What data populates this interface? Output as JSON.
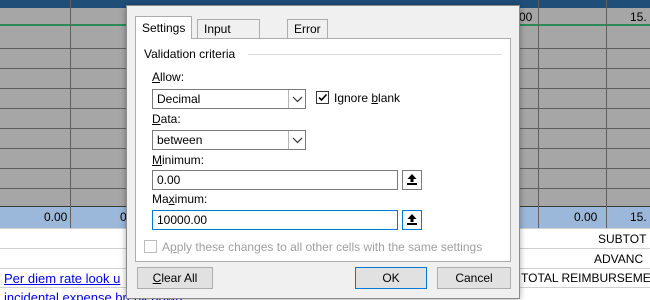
{
  "sheet": {
    "top_right_values": [
      "00",
      "15."
    ],
    "blue_row_values": [
      "0.00",
      "0",
      "0.00",
      "15."
    ],
    "right_labels": [
      "SUBTOT",
      "ADVANC",
      "TOTAL REIMBURSEMEN"
    ],
    "links": [
      "Per diem rate look u",
      "incidental expense break down"
    ]
  },
  "dialog": {
    "tabs": [
      {
        "label": "Settings",
        "active": true
      },
      {
        "label": "Input Message",
        "active": false
      },
      {
        "label": "Error Alert",
        "active": false
      }
    ],
    "group_title": "Validation criteria",
    "allow": {
      "label_prefix": "",
      "label_ul": "A",
      "label_rest": "llow:",
      "value": "Decimal"
    },
    "ignore_blank": {
      "label_pre": "Ignore ",
      "label_ul": "b",
      "label_post": "lank",
      "checked": true
    },
    "data": {
      "label_ul": "D",
      "label_rest": "ata:",
      "value": "between"
    },
    "minimum": {
      "label_ul": "M",
      "label_rest": "inimum:",
      "value": "0.00"
    },
    "maximum": {
      "label_pre": "Ma",
      "label_ul": "x",
      "label_rest": "imum:",
      "value": "10000.00"
    },
    "apply_all": {
      "label_pre": "A",
      "label_ul": "p",
      "label_post": "ply these changes to all other cells with the same settings",
      "checked": false,
      "disabled": true
    },
    "buttons": {
      "clear_ul": "C",
      "clear_rest": "lear All",
      "ok": "OK",
      "cancel": "Cancel"
    }
  }
}
